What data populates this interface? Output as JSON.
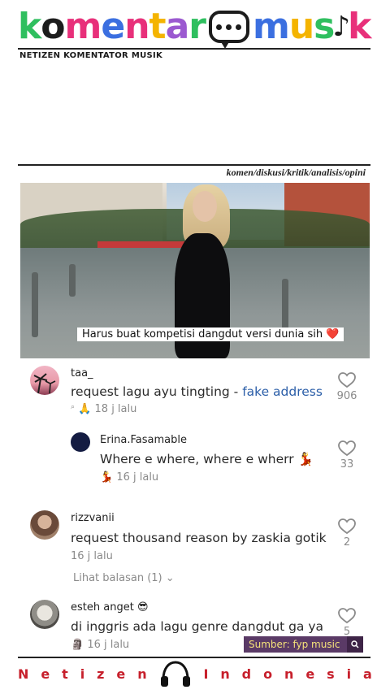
{
  "header": {
    "logo_parts": [
      {
        "text": "k",
        "color": "#2fbf5f"
      },
      {
        "text": "o",
        "color": "#1c1c1c"
      },
      {
        "text": "m",
        "color": "#e8307a"
      },
      {
        "text": "e",
        "color": "#3b6fe0"
      },
      {
        "text": "n",
        "color": "#e8307a"
      },
      {
        "text": "t",
        "color": "#f4b400"
      },
      {
        "text": "a",
        "color": "#9b59d0"
      },
      {
        "text": "r",
        "color": "#2fbf5f"
      }
    ],
    "logo_parts_right": [
      {
        "text": "m",
        "color": "#3b6fe0"
      },
      {
        "text": "u",
        "color": "#f4b400"
      },
      {
        "text": "s",
        "color": "#2fbf5f"
      },
      {
        "text": "k",
        "color": "#e8307a"
      }
    ],
    "subtitle": "NETIZEN KOMENTATOR MUSIK",
    "tagline": "komen/diskusi/kritik/analisis/opini"
  },
  "video": {
    "caption": "Harus buat kompetisi dangdut versi dunia sih",
    "caption_emoji": "❤️"
  },
  "comments": [
    {
      "username": "taa_",
      "text": "request lagu ayu tingting - ",
      "link": "fake address",
      "meta_emoji": "🙏",
      "time": "18 j lalu",
      "likes": "906",
      "avatar": "palm-avatar"
    },
    {
      "username": "Erina.Fasamable",
      "text": "Where e where, where e wherr",
      "text_emoji": "💃",
      "meta_emoji": "💃",
      "time": "16 j lalu",
      "likes": "33",
      "avatar": "navy-avatar"
    },
    {
      "username": "rizzvanii",
      "text": "request thousand reason by zaskia gotik",
      "time": "16 j lalu",
      "likes": "2",
      "replies": "Lihat balasan (1)",
      "avatar": "portrait-avatar"
    },
    {
      "username": "esteh anget",
      "username_emoji": "😎",
      "text": "di inggris ada lagu genre dangdut ga ya",
      "meta_emoji": "🗿",
      "time": "16 j lalu",
      "likes": "5",
      "avatar": "cat-avatar"
    }
  ],
  "source": {
    "label": "Sumber: fyp music"
  },
  "footer": {
    "left_letters": [
      "N",
      "e",
      "t",
      "i",
      "z",
      "e",
      "n"
    ],
    "right_letters": [
      "I",
      "n",
      "d",
      "o",
      "n",
      "e",
      "s",
      "i",
      "a"
    ]
  },
  "colors": {
    "accent_red": "#c7202c",
    "link_blue": "#2b5ea8",
    "source_bg": "#5a3a66",
    "source_text": "#f5e27a"
  },
  "icons": [
    "chat-bubble-icon",
    "music-note-icon",
    "heart-icon",
    "chevron-down-icon",
    "search-icon",
    "headphones-icon",
    "search-tiny-icon"
  ]
}
